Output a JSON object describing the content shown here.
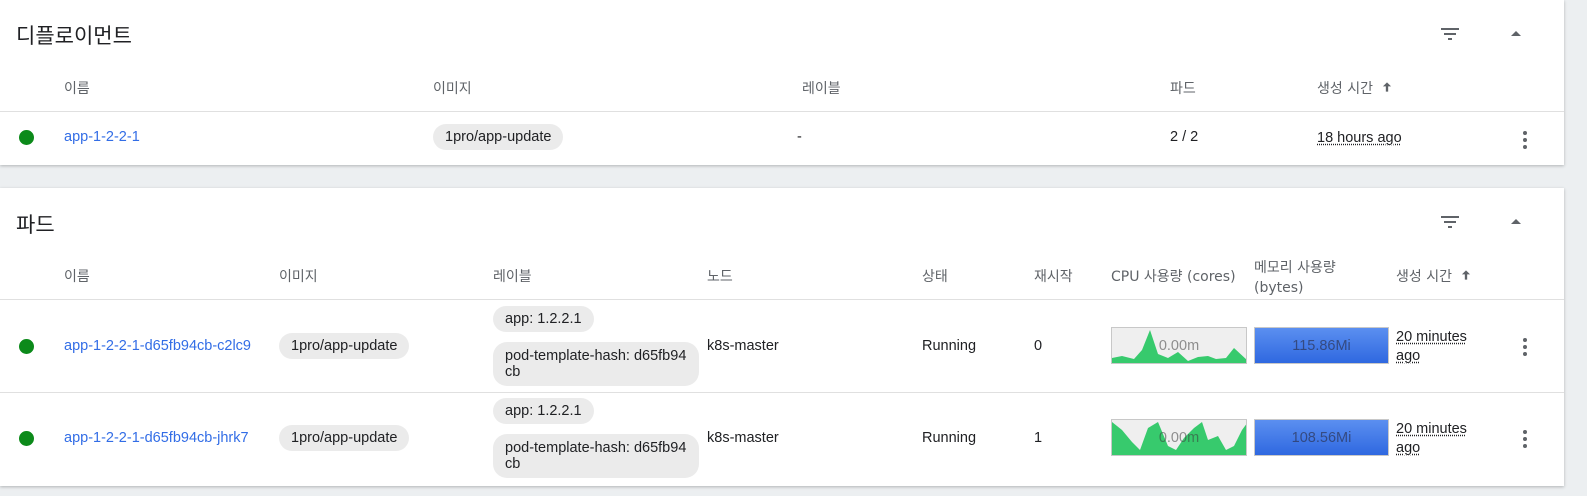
{
  "colors": {
    "link": "#326de6",
    "status_ok": "#0c8a1a",
    "cpu_fill": "#22c55e",
    "mem_fill": "#3a74e6"
  },
  "deployments": {
    "title": "디플로이먼트",
    "icons": [
      "filter-icon",
      "collapse-icon"
    ],
    "columns": {
      "name": "이름",
      "images": "이미지",
      "labels": "레이블",
      "pods": "파드",
      "created": "생성 시간",
      "sort_icon": "arrow-up-icon"
    },
    "rows": [
      {
        "name": "app-1-2-2-1",
        "image": "1pro/app-update",
        "labels": "-",
        "pods": "2 / 2",
        "created": "18 hours ago",
        "menu_icon": "more-vert-icon"
      }
    ]
  },
  "pods": {
    "title": "파드",
    "icons": [
      "filter-icon",
      "collapse-icon"
    ],
    "columns": {
      "name": "이름",
      "images": "이미지",
      "labels": "레이블",
      "node": "노드",
      "status": "상태",
      "restarts": "재시작",
      "cpu": "CPU 사용량 (cores)",
      "memory_line1": "메모리 사용량",
      "memory_line2": "(bytes)",
      "created": "생성 시간",
      "sort_icon": "arrow-up-icon"
    },
    "rows": [
      {
        "name": "app-1-2-2-1-d65fb94cb-c2lc9",
        "image": "1pro/app-update",
        "label1": "app: 1.2.2.1",
        "label2": "pod-template-hash: d65fb94cb",
        "node": "k8s-master",
        "status": "Running",
        "restarts": "0",
        "cpu": "0.00m",
        "memory": "115.86Mi",
        "created_line1": "20 minutes",
        "created_line2": "ago",
        "menu_icon": "more-vert-icon"
      },
      {
        "name": "app-1-2-2-1-d65fb94cb-jhrk7",
        "image": "1pro/app-update",
        "label1": "app: 1.2.2.1",
        "label2": "pod-template-hash: d65fb94cb",
        "node": "k8s-master",
        "status": "Running",
        "restarts": "1",
        "cpu": "0.00m",
        "memory": "108.56Mi",
        "created_line1": "20 minutes",
        "created_line2": "ago",
        "menu_icon": "more-vert-icon"
      }
    ]
  }
}
